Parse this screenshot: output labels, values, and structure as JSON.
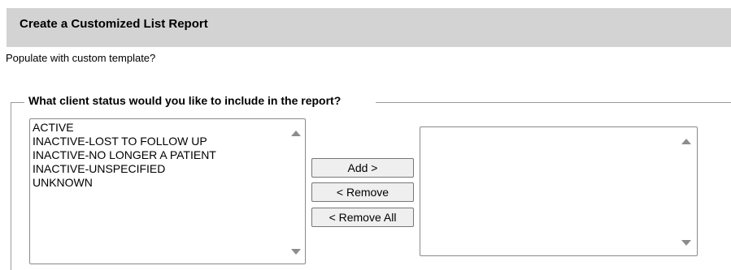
{
  "header": {
    "title": "Create a Customized List Report"
  },
  "template": {
    "label": "Populate with custom template?"
  },
  "status_section": {
    "legend": "What client status would you like to include in the report?",
    "available": [
      "ACTIVE",
      "INACTIVE-LOST TO FOLLOW UP",
      "INACTIVE-NO LONGER A PATIENT",
      "INACTIVE-UNSPECIFIED",
      "UNKNOWN"
    ],
    "selected": [],
    "buttons": {
      "add": "Add >",
      "remove": "< Remove",
      "remove_all": "< Remove All"
    }
  },
  "icons": {
    "scroll_up": "triangle-up",
    "scroll_down": "triangle-down"
  },
  "colors": {
    "header_bg": "#d3d3d3",
    "border": "#8a8a8a",
    "button_bg": "#efefef"
  }
}
